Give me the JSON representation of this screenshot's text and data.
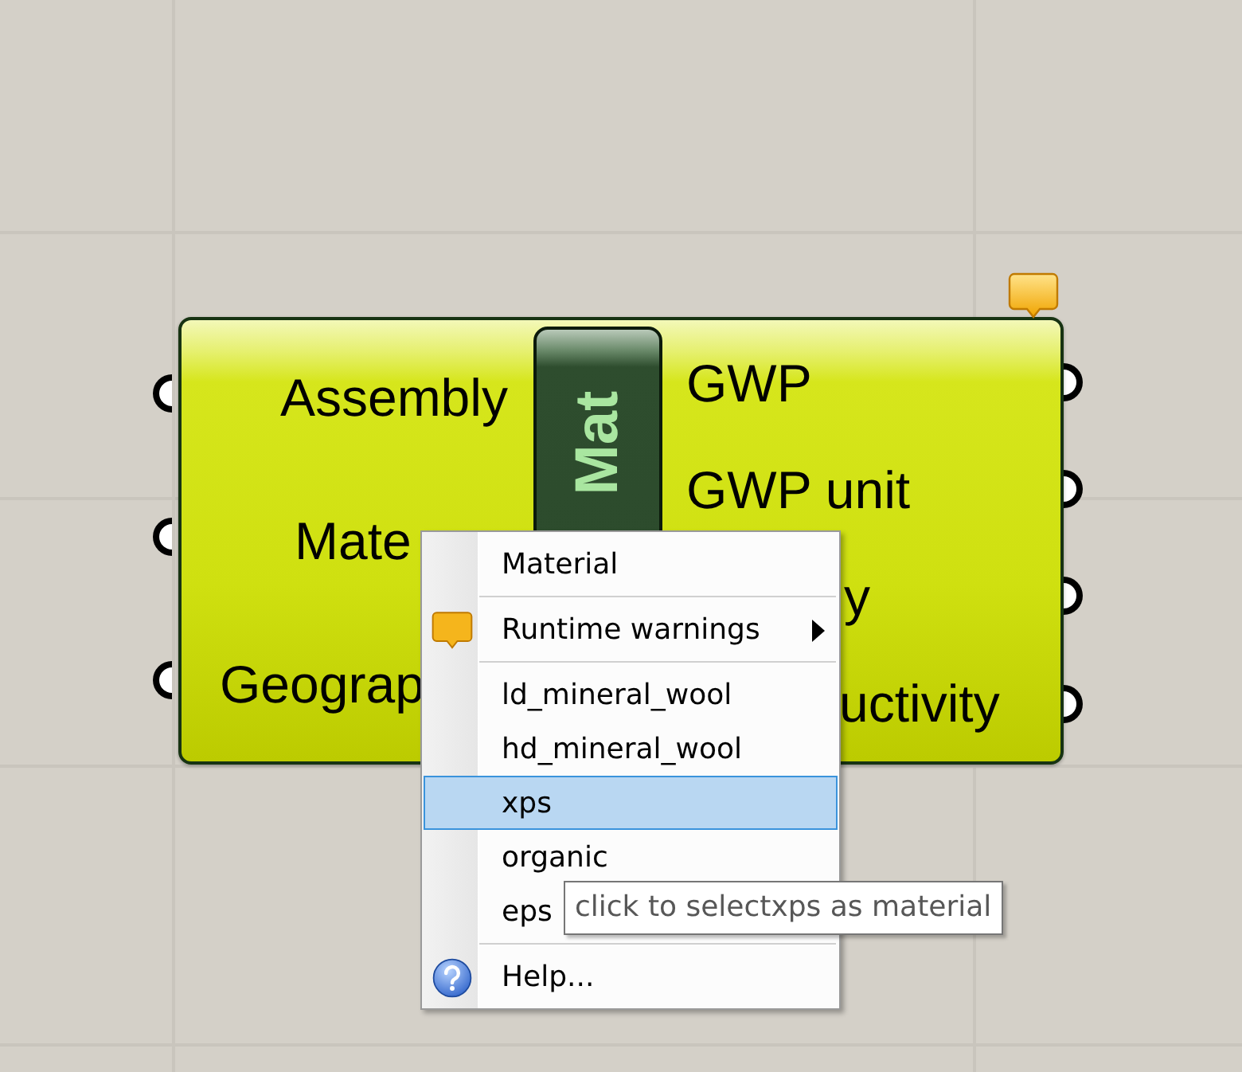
{
  "node": {
    "nickname": "Mat",
    "warning": true,
    "inputs": [
      {
        "label": "Assembly"
      },
      {
        "label": "Mate"
      },
      {
        "label": "Geograp"
      }
    ],
    "outputs": [
      {
        "label": "GWP"
      },
      {
        "label": "GWP unit"
      },
      {
        "label": "y"
      },
      {
        "label": "uctivity"
      }
    ]
  },
  "context_menu": {
    "items": [
      {
        "kind": "title",
        "label": "Material"
      },
      {
        "kind": "separator"
      },
      {
        "kind": "submenu",
        "label": "Runtime warnings"
      },
      {
        "kind": "separator"
      },
      {
        "kind": "option",
        "label": "ld_mineral_wool",
        "selected": false
      },
      {
        "kind": "option",
        "label": "hd_mineral_wool",
        "selected": false
      },
      {
        "kind": "option",
        "label": "xps",
        "selected": true
      },
      {
        "kind": "option",
        "label": "organic",
        "selected": false
      },
      {
        "kind": "option",
        "label": "eps",
        "selected": false
      },
      {
        "kind": "separator"
      },
      {
        "kind": "help",
        "label": "Help..."
      }
    ]
  },
  "tooltip": "click to selectxps as material"
}
